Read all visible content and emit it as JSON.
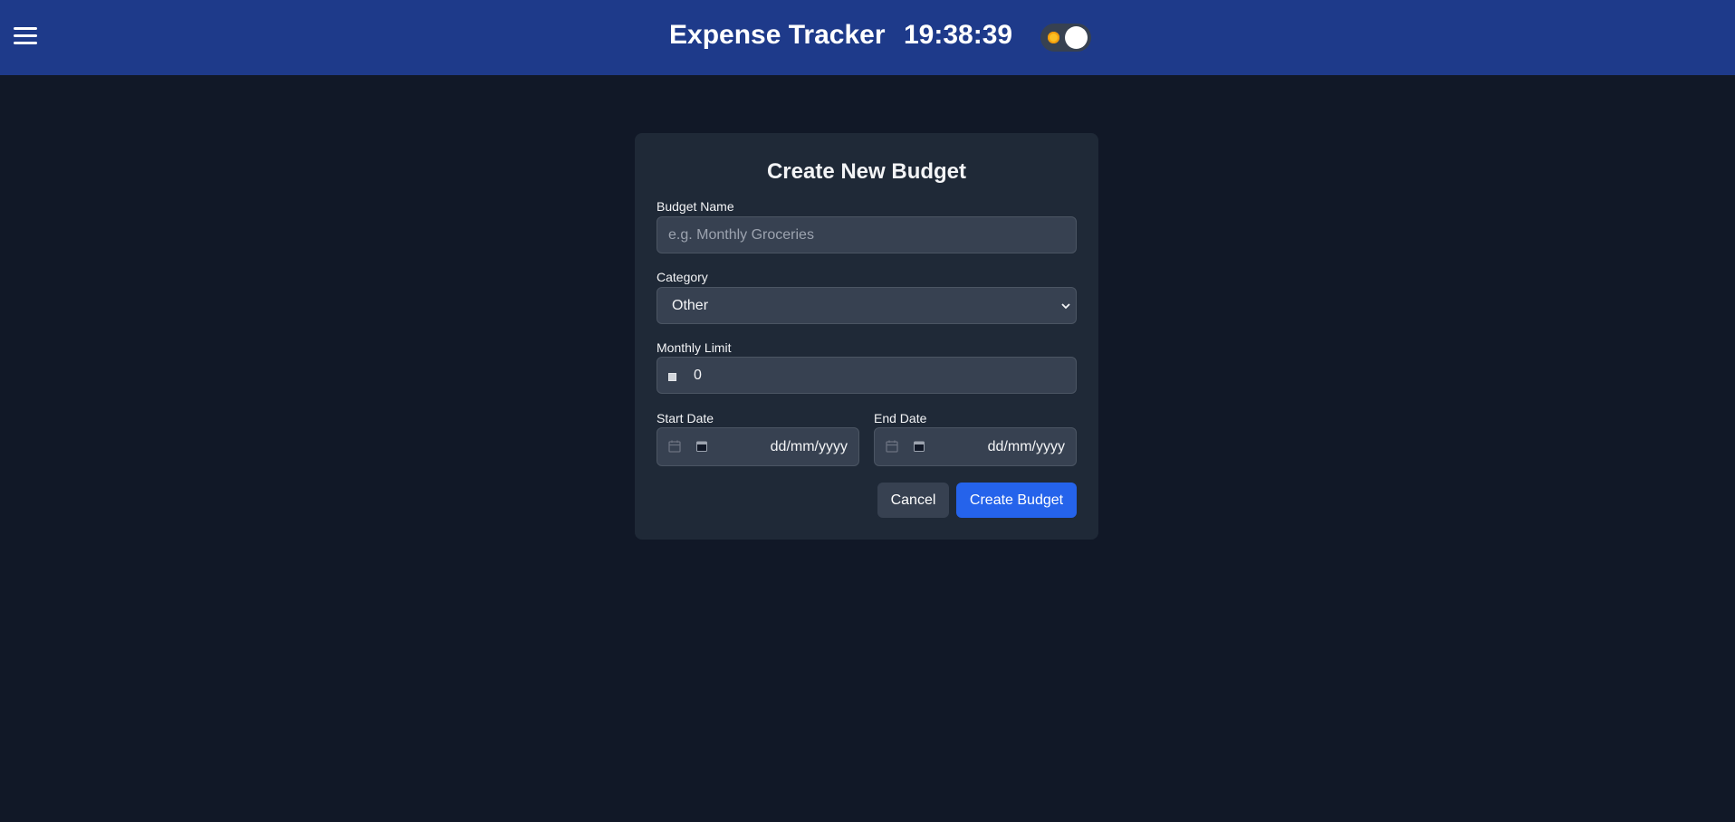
{
  "header": {
    "app_title": "Expense Tracker",
    "clock": "19:38:39",
    "menu_icon": "hamburger-menu-icon",
    "theme_icon": "sun-icon"
  },
  "form": {
    "title": "Create New Budget",
    "budget_name": {
      "label": "Budget Name",
      "value": "",
      "placeholder": "e.g. Monthly Groceries"
    },
    "category": {
      "label": "Category",
      "selected": "Other"
    },
    "monthly_limit": {
      "label": "Monthly Limit",
      "value": "0",
      "icon": "currency-icon"
    },
    "start_date": {
      "label": "Start Date",
      "value": "dd/mm/yyyy",
      "icon": "calendar-icon"
    },
    "end_date": {
      "label": "End Date",
      "value": "dd/mm/yyyy",
      "icon": "calendar-icon"
    },
    "cancel_label": "Cancel",
    "submit_label": "Create Budget"
  },
  "colors": {
    "header_bg": "#1e3a8a",
    "page_bg": "#111827",
    "card_bg": "#1f2937",
    "input_bg": "#374151",
    "primary": "#2563eb",
    "toggle_sun": "#fbbf24"
  }
}
